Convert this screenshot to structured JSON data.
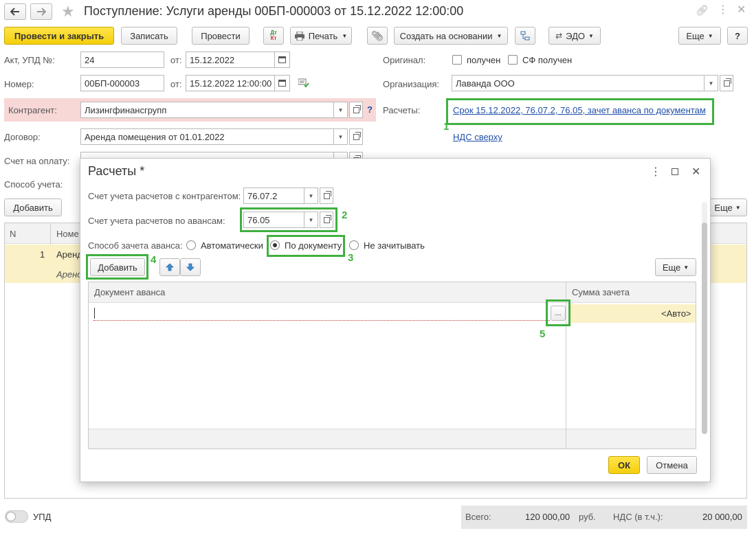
{
  "window": {
    "title": "Поступление: Услуги аренды 00БП-000003 от 15.12.2022 12:00:00"
  },
  "toolbar": {
    "post_close": "Провести и закрыть",
    "save": "Записать",
    "post": "Провести",
    "dtkt_top": "Дт",
    "dtkt_bottom": "Кт",
    "print": "Печать",
    "create_based": "Создать на основании",
    "edo": "ЭДО",
    "more": "Еще",
    "help": "?"
  },
  "form": {
    "act_label": "Акт, УПД №:",
    "act_value": "24",
    "from_label": "от:",
    "act_date": "15.12.2022",
    "number_label": "Номер:",
    "number_value": "00БП-000003",
    "number_date": "15.12.2022 12:00:00",
    "counterparty_label": "Контрагент:",
    "counterparty_value": "Лизингфинансгрупп",
    "counterparty_help": "?",
    "contract_label": "Договор:",
    "contract_value": "Аренда помещения от 01.01.2022",
    "invoice_label": "Счет на оплату:",
    "method_label": "Способ учета:",
    "original_label": "Оригинал:",
    "received": "получен",
    "sf_received": "СФ получен",
    "org_label": "Организация:",
    "org_value": "Лаванда ООО",
    "settlements_label": "Расчеты:",
    "settlements_link": "Срок 15.12.2022, 76.07.2, 76.05, зачет аванса по документам",
    "vat_link": "НДС сверху",
    "add_button": "Добавить",
    "more_button": "Еще",
    "col_n": "N",
    "col_name": "Номе",
    "row1_n": "1",
    "row1_name": "Аренд",
    "row1_sub": "Арено"
  },
  "dialog": {
    "title": "Расчеты *",
    "acc_contractor_label": "Счет учета расчетов с контрагентом:",
    "acc_contractor_value": "76.07.2",
    "acc_advance_label": "Счет учета расчетов по авансам:",
    "acc_advance_value": "76.05",
    "method_label": "Способ зачета аванса:",
    "opt_auto": "Автоматически",
    "opt_by_doc": "По документу",
    "opt_none": "Не зачитывать",
    "add_button": "Добавить",
    "more_button": "Еще",
    "col_document": "Документ аванса",
    "col_sum": "Сумма зачета",
    "row_sum": "<Авто>",
    "ellipsis": "...",
    "ok": "ОК",
    "cancel": "Отмена"
  },
  "annotations": [
    "1",
    "2",
    "3",
    "4",
    "5"
  ],
  "footer": {
    "upd_label": "УПД",
    "total_label": "Всего:",
    "total_value": "120 000,00",
    "currency": "руб.",
    "vat_label": "НДС (в т.ч.):",
    "vat_value": "20 000,00"
  },
  "colors": {
    "primary_button": "#f5cf0c",
    "highlight_green": "#3fb03f",
    "required_bg": "#f8d7d7",
    "selected_row": "#fbf1c7",
    "link": "#1f4fa8"
  }
}
